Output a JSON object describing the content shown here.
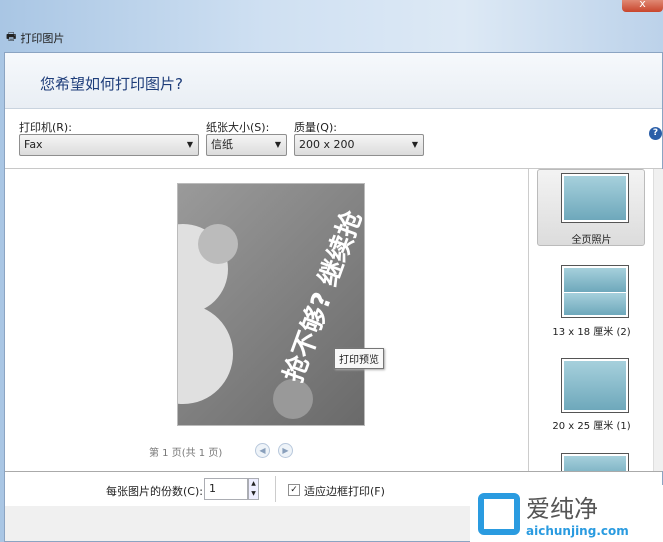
{
  "window": {
    "title": "打印图片",
    "close_label": "x"
  },
  "dialog": {
    "heading": "您希望如何打印图片?"
  },
  "toolbar": {
    "printer_label": "打印机(R):",
    "printer_value": "Fax",
    "paper_label": "纸张大小(S):",
    "paper_value": "信纸",
    "quality_label": "质量(Q):",
    "quality_value": "200 x 200",
    "help": "?"
  },
  "preview": {
    "poster_text": "抢不够? 继续抢",
    "tooltip": "打印预览",
    "page_info": "第 1 页(共 1 页)"
  },
  "layouts": [
    {
      "label": "全页照片",
      "selected": true
    },
    {
      "label": "13 x 18 厘米 (2)"
    },
    {
      "label": "20 x 25 厘米 (1)"
    }
  ],
  "bottom": {
    "copies_label": "每张图片的份数(C):",
    "copies_value": "1",
    "fit_label": "适应边框打印(F)",
    "fit_checked": true
  },
  "watermark": {
    "name": "爱纯净",
    "url": "aichunjing.com"
  }
}
